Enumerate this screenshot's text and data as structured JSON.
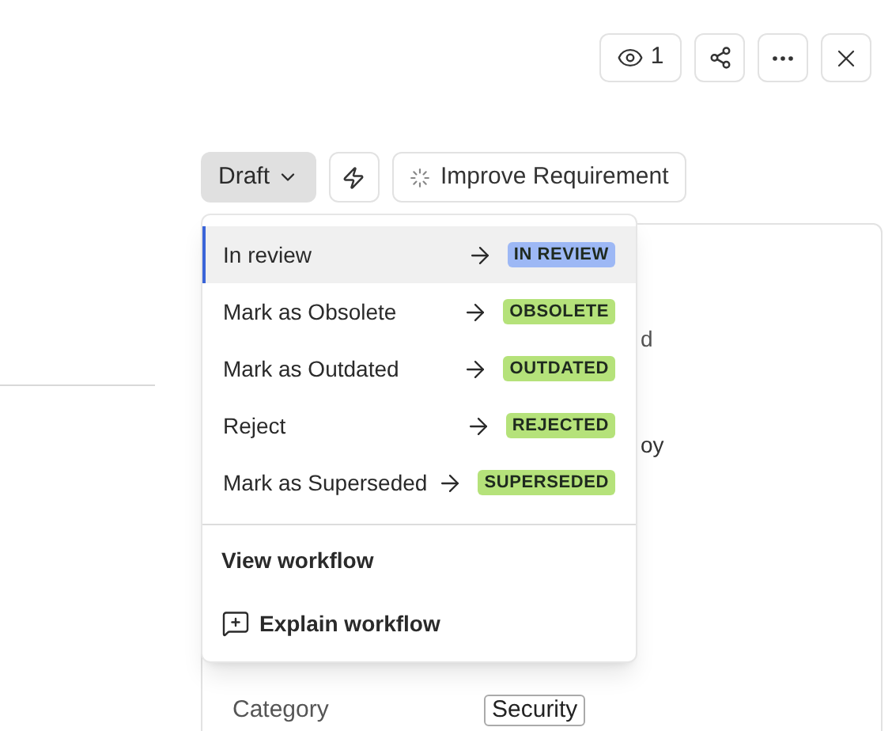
{
  "header": {
    "viewers": "1"
  },
  "toolbar": {
    "status": "Draft",
    "improve": "Improve Requirement"
  },
  "details": {
    "fragment_1": "d",
    "fragment_2": "oy",
    "fields": [
      {
        "label": "Category",
        "value": "Security"
      }
    ]
  },
  "menu": {
    "transitions": [
      {
        "label": "In review",
        "target": "IN REVIEW",
        "color": "#9db8f5",
        "selected": true
      },
      {
        "label": "Mark as Obsolete",
        "target": "OBSOLETE",
        "color": "#b5e27a",
        "selected": false
      },
      {
        "label": "Mark as Outdated",
        "target": "OUTDATED",
        "color": "#b5e27a",
        "selected": false
      },
      {
        "label": "Reject",
        "target": "REJECTED",
        "color": "#b5e27a",
        "selected": false
      },
      {
        "label": "Mark as Superseded",
        "target": "SUPERSEDED",
        "color": "#b5e27a",
        "selected": false
      }
    ],
    "view_workflow": "View workflow",
    "explain_workflow": "Explain workflow"
  }
}
